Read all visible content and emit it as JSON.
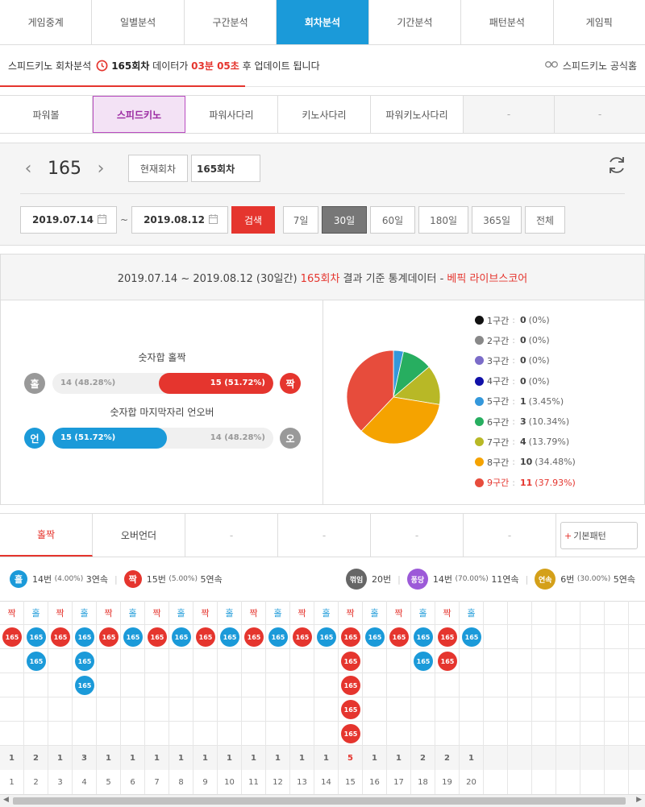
{
  "top_tabs": [
    "게임중계",
    "일별분석",
    "구간분석",
    "회차분석",
    "기간분석",
    "패턴분석",
    "게임픽"
  ],
  "top_active": 3,
  "info": {
    "prefix": "스피드키노 회차분석",
    "round": "165회차",
    "mid": "데이터가",
    "time": "03분 05초",
    "suffix": "후 업데이트 됩니다",
    "official": "스피드키노 공식홈",
    "progress": 0.38
  },
  "sub_tabs": [
    "파워볼",
    "스피드키노",
    "파워사다리",
    "키노사다리",
    "파워키노사다리",
    "-",
    "-"
  ],
  "sub_active": 1,
  "search": {
    "round": "165",
    "current_btn": "현재회차",
    "round_input": "165회차",
    "start_date": "2019.07.14",
    "tilde": "~",
    "end_date": "2019.08.12",
    "search_btn": "검색",
    "periods": [
      "7일",
      "30일",
      "60일",
      "180일",
      "365일",
      "전체"
    ],
    "period_active": 1
  },
  "stats": {
    "header_prefix": "2019.07.14 ~ 2019.08.12 (30일간)",
    "header_round": "165회차",
    "header_mid": "결과 기준 통계데이터 -",
    "header_source": "베픽 라이브스코어",
    "oddeven": {
      "label": "숫자합 홀짝",
      "left_char": "홀",
      "right_char": "짝",
      "left_text": "14 (48.28%)",
      "right_text": "15 (51.72%)",
      "right_fraction": 0.5172
    },
    "underover": {
      "label": "숫자합 마지막자리 언오버",
      "left_char": "언",
      "right_char": "오",
      "left_text": "15 (51.72%)",
      "right_text": "14 (48.28%)",
      "left_fraction": 0.5172
    }
  },
  "chart_data": {
    "type": "pie",
    "categories": [
      "1구간",
      "2구간",
      "3구간",
      "4구간",
      "5구간",
      "6구간",
      "7구간",
      "8구간",
      "9구간"
    ],
    "values": [
      0,
      0,
      0,
      0,
      1,
      3,
      4,
      10,
      11
    ],
    "percents": [
      "(0%)",
      "(0%)",
      "(0%)",
      "(0%)",
      "(3.45%)",
      "(10.34%)",
      "(13.79%)",
      "(34.48%)",
      "(37.93%)"
    ],
    "colors": [
      "#111111",
      "#888888",
      "#7b6cc8",
      "#1010a8",
      "#3498db",
      "#27ae60",
      "#b8b826",
      "#f5a300",
      "#e74c3c"
    ],
    "highlight": 8,
    "legend": "right"
  },
  "pattern_tabs": [
    "홀짝",
    "오버언더",
    "-",
    "-",
    "-",
    "-"
  ],
  "pattern_active": 0,
  "basic_pattern": "기본패턴",
  "summary": {
    "odd_char": "홀",
    "odd_count": "14번",
    "odd_pct": "(4.00%)",
    "odd_streak": "3연속",
    "even_char": "짝",
    "even_count": "15번",
    "even_pct": "(5.00%)",
    "even_streak": "5연속",
    "break_char": "꺾임",
    "break_count": "20번",
    "pong_char": "퐁당",
    "pong_count": "14번",
    "pong_pct": "(70.00%)",
    "pong_streak": "11연속",
    "cont_char": "연속",
    "cont_count": "6번",
    "cont_pct": "(30.00%)",
    "cont_streak": "5연속"
  },
  "pattern": {
    "ball_label": "165",
    "columns": [
      {
        "type": "짝",
        "count": 1,
        "idx": "1"
      },
      {
        "type": "홀",
        "count": 2,
        "idx": "2"
      },
      {
        "type": "짝",
        "count": 1,
        "idx": "3"
      },
      {
        "type": "홀",
        "count": 3,
        "idx": "4"
      },
      {
        "type": "짝",
        "count": 1,
        "idx": "5"
      },
      {
        "type": "홀",
        "count": 1,
        "idx": "6"
      },
      {
        "type": "짝",
        "count": 1,
        "idx": "7"
      },
      {
        "type": "홀",
        "count": 1,
        "idx": "8"
      },
      {
        "type": "짝",
        "count": 1,
        "idx": "9"
      },
      {
        "type": "홀",
        "count": 1,
        "idx": "10"
      },
      {
        "type": "짝",
        "count": 1,
        "idx": "11"
      },
      {
        "type": "홀",
        "count": 1,
        "idx": "12"
      },
      {
        "type": "짝",
        "count": 1,
        "idx": "13"
      },
      {
        "type": "홀",
        "count": 1,
        "idx": "14"
      },
      {
        "type": "짝",
        "count": 5,
        "idx": "15"
      },
      {
        "type": "홀",
        "count": 1,
        "idx": "16"
      },
      {
        "type": "짝",
        "count": 1,
        "idx": "17"
      },
      {
        "type": "홀",
        "count": 2,
        "idx": "18"
      },
      {
        "type": "짝",
        "count": 2,
        "idx": "19"
      },
      {
        "type": "홀",
        "count": 1,
        "idx": "20"
      }
    ],
    "max_highlight": 15,
    "colors": {
      "odd": "#1b9ad9",
      "even": "#e5352e"
    }
  }
}
